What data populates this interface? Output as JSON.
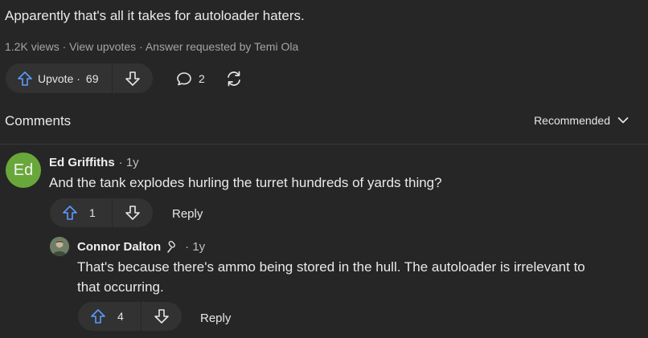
{
  "answer": {
    "text": "Apparently that's all it takes for autoloader haters.",
    "views": "1.2K views",
    "view_upvotes": "View upvotes",
    "requested": "Answer requested by Temi Ola",
    "separator": "·",
    "upvote_label": "Upvote ·",
    "upvote_count": "69",
    "comment_count": "2"
  },
  "comments_section": {
    "title": "Comments",
    "sort_label": "Recommended"
  },
  "comments": [
    {
      "avatar_initials": "Ed",
      "avatar_color": "#6aa73a",
      "author": "Ed Griffiths",
      "time": "· 1y",
      "body": "And the tank explodes hurling the turret hundreds of yards thing?",
      "upvotes": "1",
      "reply_label": "Reply"
    },
    {
      "author": "Connor Dalton",
      "time": "· 1y",
      "body_line1": "That's because there's ammo being stored in the hull. The autoloader is irrelevant to",
      "body_line2": "that occurring.",
      "upvotes": "4",
      "reply_label": "Reply"
    }
  ],
  "icons": {
    "upvote": "arrow-up-icon",
    "downvote": "arrow-down-icon",
    "comment": "comment-bubble-icon",
    "share": "reshare-icon",
    "chevron": "chevron-down-icon",
    "author_badge": "microphone-icon"
  },
  "colors": {
    "background": "#262626",
    "pill": "#323232",
    "upvote_blue": "#5c9bff",
    "text": "#e6e6e6",
    "muted": "#a4a4a4"
  }
}
